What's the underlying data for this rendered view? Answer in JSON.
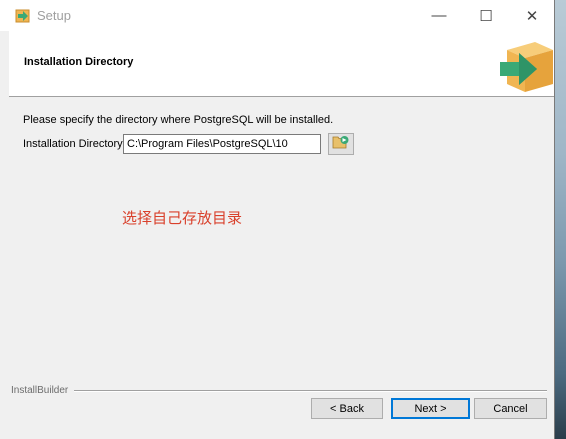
{
  "window": {
    "title": "Setup",
    "minimize_glyph": "—",
    "maximize_glyph": "☐",
    "close_glyph": "✕"
  },
  "header": {
    "title": "Installation Directory",
    "logo_icon": "installer-arrow-box-icon"
  },
  "main": {
    "description": "Please specify the directory where PostgreSQL will be installed.",
    "directory_label": "Installation Directory",
    "directory_value": "C:\\Program Files\\PostgreSQL\\10",
    "browse_icon": "folder-browse-icon",
    "annotation": "选择自己存放目录"
  },
  "footer": {
    "brand": "InstallBuilder",
    "back_label": "< Back",
    "next_label": "Next >",
    "cancel_label": "Cancel"
  },
  "colors": {
    "annotation": "#d9402b",
    "logo_green": "#3aa976",
    "logo_box": "#f0b552"
  }
}
